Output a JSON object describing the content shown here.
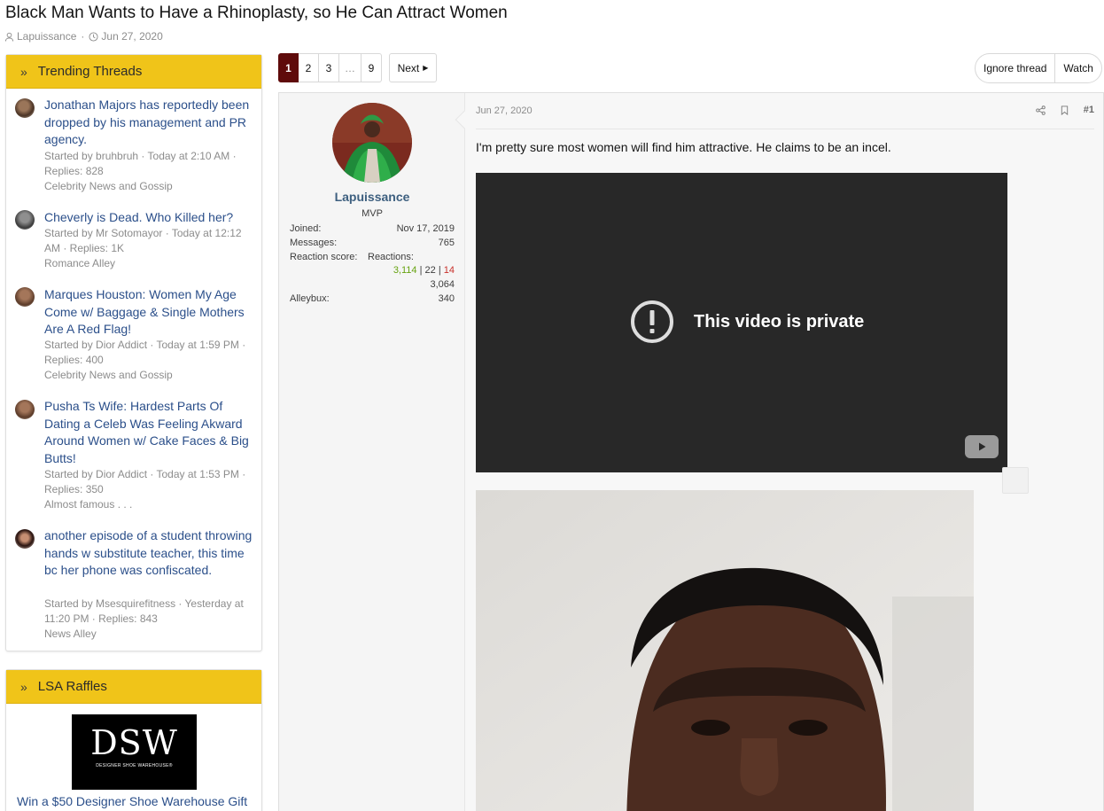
{
  "thread": {
    "title": "Black Man Wants to Have a Rhinoplasty, so He Can Attract Women",
    "author": "Lapuissance",
    "date": "Jun 27, 2020"
  },
  "sidebar": {
    "trending_title": "Trending Threads",
    "threads": [
      {
        "title": "Jonathan Majors has reportedly been dropped by his management and PR agency.",
        "meta": "Started by bruhbruh · Today at 2:10 AM · Replies: 828",
        "forum": "Celebrity News and Gossip"
      },
      {
        "title": "Cheverly is Dead. Who Killed her?",
        "meta": "Started by Mr Sotomayor · Today at 12:12 AM · Replies: 1K",
        "forum": "Romance Alley"
      },
      {
        "title": "Marques Houston: Women My Age Come w/ Baggage & Single Mothers Are A Red Flag!",
        "meta": "Started by Dior Addict · Today at 1:59 PM · Replies: 400",
        "forum": "Celebrity News and Gossip"
      },
      {
        "title": "Pusha Ts Wife: Hardest Parts Of Dating a Celeb Was Feeling Akward Around Women w/ Cake Faces & Big Butts!",
        "meta": "Started by Dior Addict · Today at 1:53 PM · Replies: 350",
        "forum": "Almost famous . . ."
      },
      {
        "title": "another episode of a student throwing hands w substitute teacher, this time bc her phone was confiscated.",
        "meta": "Started by Msesquirefitness · Yesterday at 11:20 PM · Replies: 843",
        "forum": "News Alley"
      }
    ],
    "raffles_title": "LSA Raffles",
    "raffle_logo": "DSW",
    "raffle_logo_sub": "DESIGNER SHOE WAREHOUSE®",
    "raffle_text": "Win a $50 Designer Shoe Warehouse Gift"
  },
  "pagination": {
    "pages": [
      "1",
      "2",
      "3",
      "…",
      "9"
    ],
    "current": "1",
    "next_label": "Next"
  },
  "actions": {
    "ignore_label": "Ignore thread",
    "watch_label": "Watch"
  },
  "post": {
    "username": "Lapuissance",
    "user_title": "MVP",
    "joined_label": "Joined:",
    "joined": "Nov 17, 2019",
    "messages_label": "Messages:",
    "messages": "765",
    "reaction_label": "Reaction score:",
    "reactions_label": "Reactions:",
    "reactions_pos": "3,114",
    "reactions_neu": "22",
    "reactions_neg": "14",
    "reaction_score": "3,064",
    "alleybux_label": "Alleybux:",
    "alleybux": "340",
    "date": "Jun 27, 2020",
    "number": "#1",
    "body": "I'm pretty sure most women will find him attractive. He claims to be an incel.",
    "video_message": "This video is private"
  }
}
